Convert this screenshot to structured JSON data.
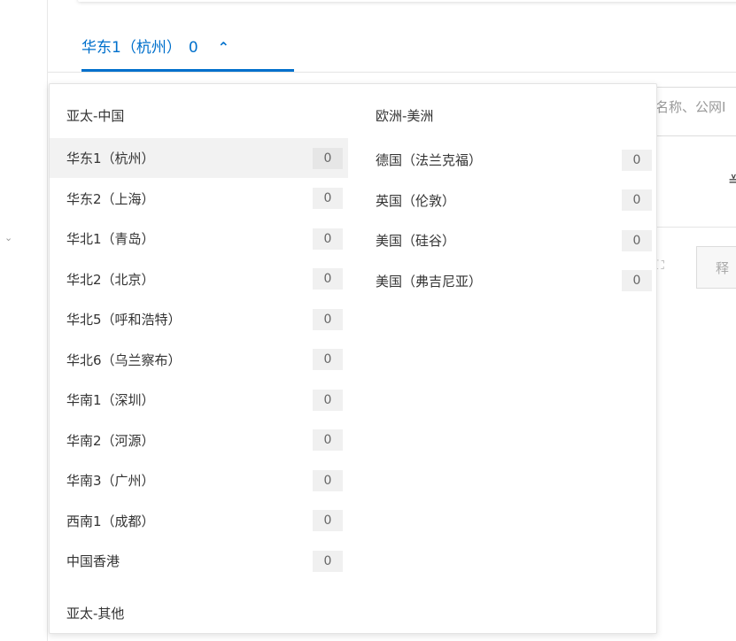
{
  "rail": {
    "chevron": "⌄"
  },
  "tab": {
    "label": "华东1（杭州）",
    "count": "0",
    "caret": "⌃"
  },
  "background": {
    "search_placeholder": "名称、公网I",
    "char": "≚",
    "btn_icon": "⛶",
    "btn_label": "释"
  },
  "dropdown": {
    "groups": [
      {
        "title": "亚太-中国",
        "items": [
          {
            "name": "华东1（杭州）",
            "count": "0",
            "selected": true
          },
          {
            "name": "华东2（上海）",
            "count": "0"
          },
          {
            "name": "华北1（青岛）",
            "count": "0"
          },
          {
            "name": "华北2（北京）",
            "count": "0"
          },
          {
            "name": "华北5（呼和浩特）",
            "count": "0"
          },
          {
            "name": "华北6（乌兰察布）",
            "count": "0"
          },
          {
            "name": "华南1（深圳）",
            "count": "0"
          },
          {
            "name": "华南2（河源）",
            "count": "0"
          },
          {
            "name": "华南3（广州）",
            "count": "0"
          },
          {
            "name": "西南1（成都）",
            "count": "0"
          },
          {
            "name": "中国香港",
            "count": "0"
          }
        ]
      },
      {
        "title": "欧洲-美洲",
        "items": [
          {
            "name": "德国（法兰克福）",
            "count": "0"
          },
          {
            "name": "英国（伦敦）",
            "count": "0"
          },
          {
            "name": "美国（硅谷）",
            "count": "0"
          },
          {
            "name": "美国（弗吉尼亚）",
            "count": "0"
          }
        ]
      },
      {
        "title": "亚太-其他",
        "items": []
      }
    ]
  }
}
